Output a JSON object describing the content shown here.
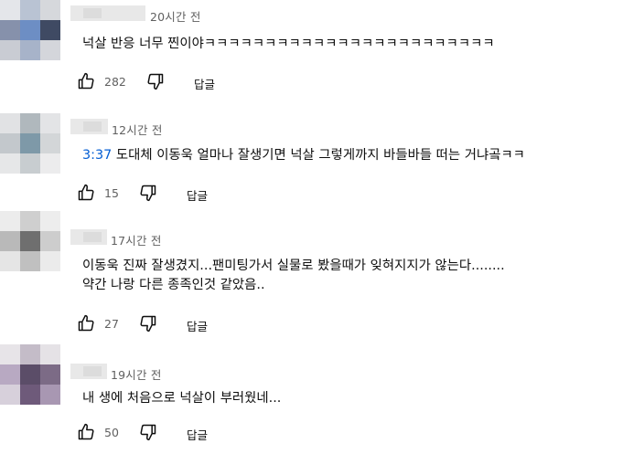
{
  "comments": [
    {
      "timestamp": "20시간 전",
      "text_line1": "넉살 반응 너무 찐이야ㅋㅋㅋㅋㅋㅋㅋㅋㅋㅋㅋㅋㅋㅋㅋㅋㅋㅋㅋㅋㅋㅋㅋㅋ",
      "likes": "282",
      "reply_label": "답글"
    },
    {
      "timestamp": "12시간 전",
      "time_link": "3:37",
      "text_line1": " 도대체 이동욱 얼마나 잘생기면 넉살 그렇게까지 바들바들 떠는 거냐곸ㅋㅋ",
      "likes": "15",
      "reply_label": "답글"
    },
    {
      "timestamp": "17시간 전",
      "text_line1": "이동욱 진짜 잘생겼지...팬미팅가서 실물로 봤을때가 잊혀지지가 않는다........",
      "text_line2": "약간 나랑 다른 종족인것 같았음..",
      "likes": "27",
      "reply_label": "답글"
    },
    {
      "timestamp": "19시간 전",
      "text_line1": "내 생에 처음으로 넉살이 부러웠네...",
      "likes": "50",
      "reply_label": "답글"
    }
  ],
  "icons": {
    "like": "thumbs-up-icon",
    "dislike": "thumbs-down-icon"
  },
  "colors": {
    "text": "#0f0f0f",
    "secondary": "#606060",
    "link": "#065fd4"
  }
}
